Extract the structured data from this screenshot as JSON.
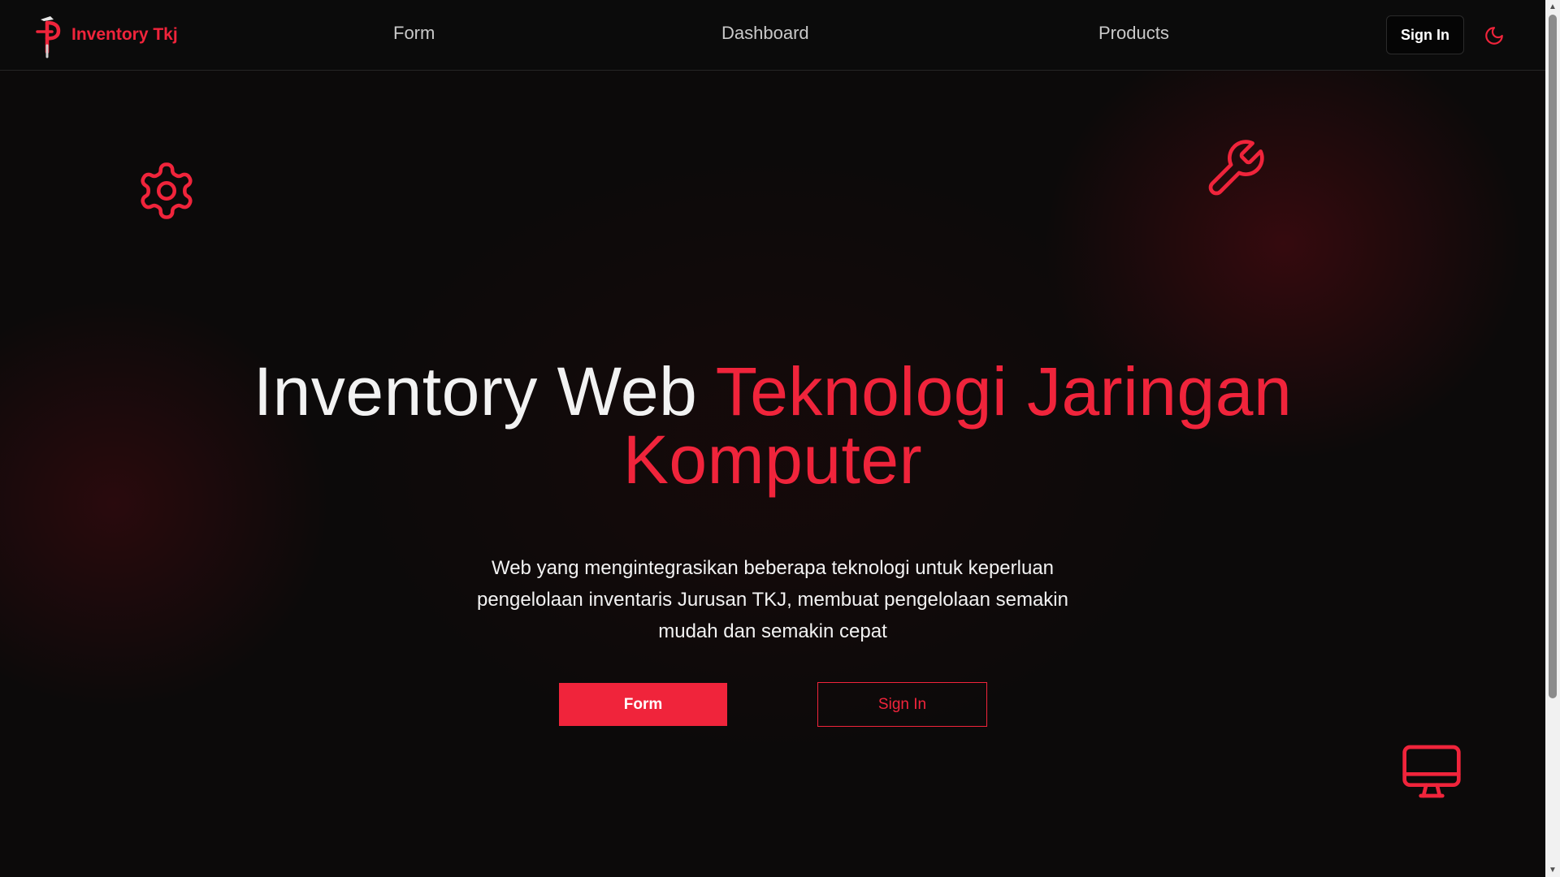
{
  "navbar": {
    "brand_name": "Inventory Tkj",
    "links": [
      {
        "label": "Form"
      },
      {
        "label": "Dashboard"
      },
      {
        "label": "Products"
      }
    ],
    "sign_in_label": "Sign In",
    "theme_toggle_icon": "moon-icon"
  },
  "hero": {
    "title_white": "Inventory Web",
    "title_red_line1": "Teknologi Jaringan",
    "title_red_line2": "Komputer",
    "description": "Web yang mengintegrasikan beberapa teknologi untuk keperluan pengelolaan inventaris Jurusan TKJ, membuat pengelolaan semakin mudah dan semakin cepat",
    "primary_button": "Form",
    "secondary_button": "Sign In"
  },
  "decorations": {
    "icons": [
      "gear-icon",
      "wrench-icon",
      "monitor-icon"
    ]
  },
  "colors": {
    "accent": "#f0243b",
    "background": "#0c0a0a",
    "navbar_bg": "#0b0b0b",
    "text": "#f2f2f2",
    "nav_text": "#c9c9c9"
  }
}
